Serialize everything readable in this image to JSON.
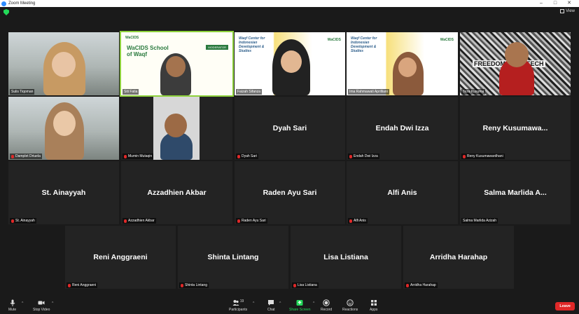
{
  "titlebar": {
    "title": "Zoom Meeting",
    "minimize": "–",
    "maximize": "□",
    "close": "✕"
  },
  "topbar": {
    "view_label": "View"
  },
  "video_tiles": [
    {
      "label": "Sulis Tiqoman",
      "muted": false,
      "color": "#e4cfb0"
    },
    {
      "label": "Siti Fatia",
      "muted": false,
      "talking": true,
      "slide_title": "WaCIDS School of Waqf",
      "slide_tag": "MODERATOR",
      "logo": "WaCIDS"
    },
    {
      "label": "Faizah Sifanza",
      "muted": false,
      "slide_sub": "Waqf Center for Indonesian Development & Studies",
      "logo": "WaCIDS"
    },
    {
      "label": "Ima Rahmawati Aprilliani",
      "muted": false,
      "slide_sub": "Waqf Center for Indonesian Development & Studies",
      "logo": "WaCIDS"
    },
    {
      "label": "Teza Kusuma",
      "muted": false,
      "banner": "FREEDOM OF SPEECH"
    },
    {
      "label": "Damplet Driuela",
      "muted": true
    },
    {
      "label": "Mumin Mutaqin",
      "muted": true
    }
  ],
  "name_tiles": [
    {
      "name": "Dyah Sari",
      "label": "Dyah Sari",
      "muted": true
    },
    {
      "name": "Endah Dwi Izza",
      "label": "Endah Dwi Izza",
      "muted": true
    },
    {
      "name": "Reny  Kusumawa...",
      "label": "Reny Kusumawardhani",
      "muted": true
    },
    {
      "name": "St. Ainayyah",
      "label": "St. Ainayyah",
      "muted": true
    },
    {
      "name": "Azzadhien Akbar",
      "label": "Azzadhien Akbar",
      "muted": true
    },
    {
      "name": "Raden Ayu Sari",
      "label": "Raden Ayu Sari",
      "muted": true
    },
    {
      "name": "Alfi Anis",
      "label": "Alfi Anis",
      "muted": true
    },
    {
      "name": "Salma Marlida A...",
      "label": "Salma Marlida Azizah",
      "muted": false
    },
    {
      "name": "Reni Anggraeni",
      "label": "Reni Anggraeni",
      "muted": true
    },
    {
      "name": "Shinta Lintang",
      "label": "Shinta Lintang",
      "muted": true
    },
    {
      "name": "Lisa Listiana",
      "label": "Lisa Listiana",
      "muted": true
    },
    {
      "name": "Arridha Harahap",
      "label": "Arridha Harahap",
      "muted": true
    }
  ],
  "toolbar": {
    "mute": "Mute",
    "stop_video": "Stop Video",
    "participants": "Participants",
    "participant_count": "19",
    "chat": "Chat",
    "share_screen": "Share Screen",
    "record": "Record",
    "reactions": "Reactions",
    "apps": "Apps",
    "leave": "Leave"
  },
  "colors": {
    "talking_outline": "#8ed13c",
    "leave": "#e02828",
    "share": "#23d959"
  }
}
